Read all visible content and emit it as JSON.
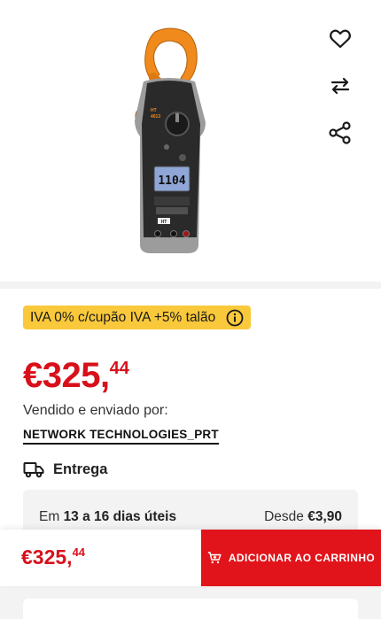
{
  "product": {
    "image_alt": "Digital clamp meter",
    "display_reading": "1104",
    "brand_mark": "HT"
  },
  "actions": {
    "favorite_icon": "heart-icon",
    "compare_icon": "compare-arrows-icon",
    "share_icon": "share-icon"
  },
  "promo": {
    "iva_text": "IVA 0% c/cupão IVA +5% talão",
    "info_icon": "info-icon"
  },
  "price": {
    "integer": "€325,",
    "cents": "44"
  },
  "seller": {
    "label": "Vendido e enviado por:",
    "name": "NETWORK TECHNOLOGIES_PRT"
  },
  "delivery": {
    "label": "Entrega",
    "prefix": "Em",
    "window": "13 a 16 dias úteis",
    "cost_prefix": "Desde",
    "cost": "€3,90"
  },
  "bottom_bar": {
    "price_integer": "€325,",
    "price_cents": "44",
    "cart_label": "ADICIONAR AO CARRINHO"
  },
  "colors": {
    "accent_red": "#e2141b",
    "price_red": "#d8101a",
    "promo_yellow": "#f9c93b"
  }
}
